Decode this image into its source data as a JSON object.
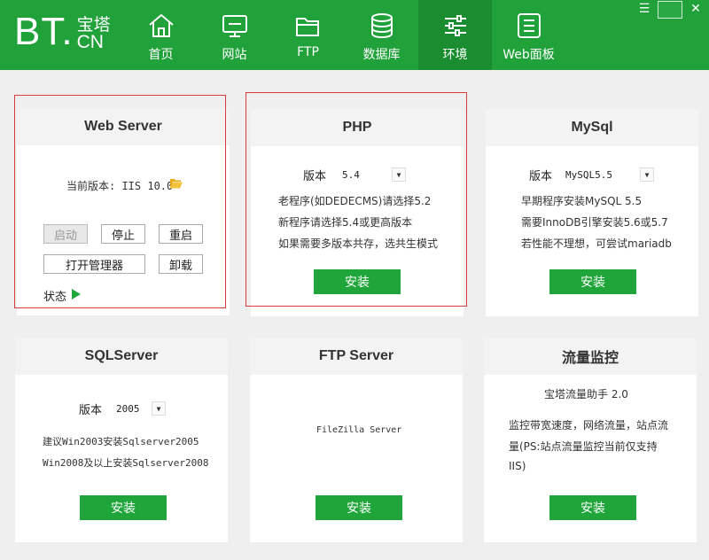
{
  "logo": {
    "bt": "BT.",
    "cn_top": "宝塔",
    "cn_bottom": "CN"
  },
  "nav": [
    {
      "label": "首页",
      "icon": "home-icon"
    },
    {
      "label": "网站",
      "icon": "monitor-icon"
    },
    {
      "label": "FTP",
      "icon": "folder-icon"
    },
    {
      "label": "数据库",
      "icon": "database-icon"
    },
    {
      "label": "环境",
      "icon": "sliders-icon",
      "active": true
    },
    {
      "label": "Web面板",
      "icon": "list-icon"
    }
  ],
  "window": {
    "menu": "☰",
    "close": "✕"
  },
  "cards": {
    "web": {
      "title": "Web Server",
      "version_label": "当前版本: IIS 10.0",
      "start": "启动",
      "stop": "停止",
      "restart": "重启",
      "open_manager": "打开管理器",
      "uninstall": "卸载",
      "status": "状态"
    },
    "php": {
      "title": "PHP",
      "version_label": "版本",
      "version_value": "5.4",
      "lines": [
        "老程序(如DEDECMS)请选择5.2",
        "新程序请选择5.4或更高版本",
        "如果需要多版本共存，选共生模式"
      ],
      "install": "安装"
    },
    "mysql": {
      "title": "MySql",
      "version_label": "版本",
      "version_value": "MySQL5.5",
      "lines": [
        "早期程序安装MySQL 5.5",
        "需要InnoDB引擎安装5.6或5.7",
        "若性能不理想，可尝试mariadb"
      ],
      "install": "安装"
    },
    "sqlserver": {
      "title": "SQLServer",
      "version_label": "版本",
      "version_value": "2005",
      "lines": [
        "建议Win2003安装Sqlserver2005",
        "Win2008及以上安装Sqlserver2008"
      ],
      "install": "安装"
    },
    "ftp": {
      "title": "FTP Server",
      "product": "FileZilla Server",
      "install": "安装"
    },
    "traffic": {
      "title": "流量监控",
      "product": "宝塔流量助手 2.0",
      "lines": [
        "监控带宽速度，网络流量，站点流",
        "量(PS:站点流量监控当前仅支持",
        "IIS)"
      ],
      "install": "安装"
    }
  }
}
